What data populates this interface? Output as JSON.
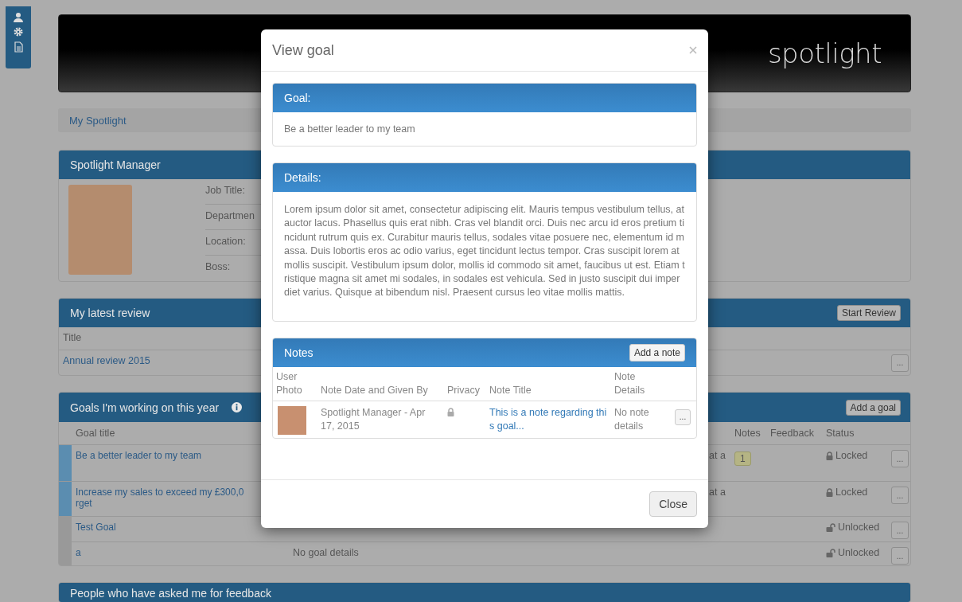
{
  "header": {
    "logo": "spotlight"
  },
  "breadcrumb": {
    "link": "My Spotlight"
  },
  "profile": {
    "title": "Spotlight Manager",
    "fields": [
      "Job Title:",
      "Departmen",
      "Location:",
      "Boss:"
    ]
  },
  "review": {
    "title": "My latest review",
    "button": "Start Review",
    "column": "Title",
    "rows": [
      {
        "title": "Annual review 2015",
        "action": "..."
      }
    ]
  },
  "goals": {
    "title": "Goals I'm working on this year",
    "button": "Add a goal",
    "columns": {
      "title": "Goal title",
      "notes": "Notes",
      "feedback": "Feedback",
      "status": "Status"
    },
    "rows": [
      {
        "title_lines": [
          "Be a better leader to my team"
        ],
        "color": "#5b8db0",
        "details_tail": "at a",
        "notes": "1",
        "status": "Locked",
        "locked": true,
        "action": "..."
      },
      {
        "title_lines": [
          "Increase my sales to exceed my £300,0",
          "rget"
        ],
        "color": "#5b8db0",
        "details_tail": "at a",
        "status": "Locked",
        "locked": true,
        "action": "..."
      },
      {
        "title_lines": [
          "Test Goal"
        ],
        "color": "#999999",
        "status": "Unlocked",
        "locked": false,
        "action": "..."
      },
      {
        "title_lines": [
          "a"
        ],
        "color": "#999999",
        "details": "No goal details",
        "status": "Unlocked",
        "locked": false,
        "action": "..."
      }
    ]
  },
  "feedback_panel": {
    "title": "People who have asked me for feedback"
  },
  "modal": {
    "title": "View goal",
    "goal": {
      "title": "Goal:",
      "text": "Be a better leader to my team"
    },
    "details": {
      "title": "Details:",
      "text": "Lorem ipsum dolor sit amet, consectetur adipiscing elit. Mauris tempus vestibulum tellus, at auctor lacus. Phasellus quis erat nibh. Cras vel blandit orci. Duis nec arcu id eros pretium tincidunt rutrum quis ex. Curabitur mauris tellus, sodales vitae posuere nec, elementum id massa. Duis lobortis eros ac odio varius, eget tincidunt lectus tempor. Cras suscipit lorem at mollis suscipit. Vestibulum ipsum dolor, mollis id commodo sit amet, faucibus ut est. Etiam tristique magna sit amet mi sodales, in sodales est vehicula. Sed in justo suscipit dui imperdiet varius. Quisque at bibendum nisl. Praesent cursus leo vitae mollis mattis."
    },
    "notes": {
      "title": "Notes",
      "button": "Add a note",
      "columns": [
        "User Photo",
        "Note Date and Given By",
        "Privacy",
        "Note Title",
        "Note Details"
      ],
      "rows": [
        {
          "given_by": "Spotlight Manager - Apr 17, 2015",
          "private": true,
          "title": "This is a note regarding this goal...",
          "details": "No note details",
          "action": "..."
        }
      ]
    },
    "close": "Close"
  }
}
